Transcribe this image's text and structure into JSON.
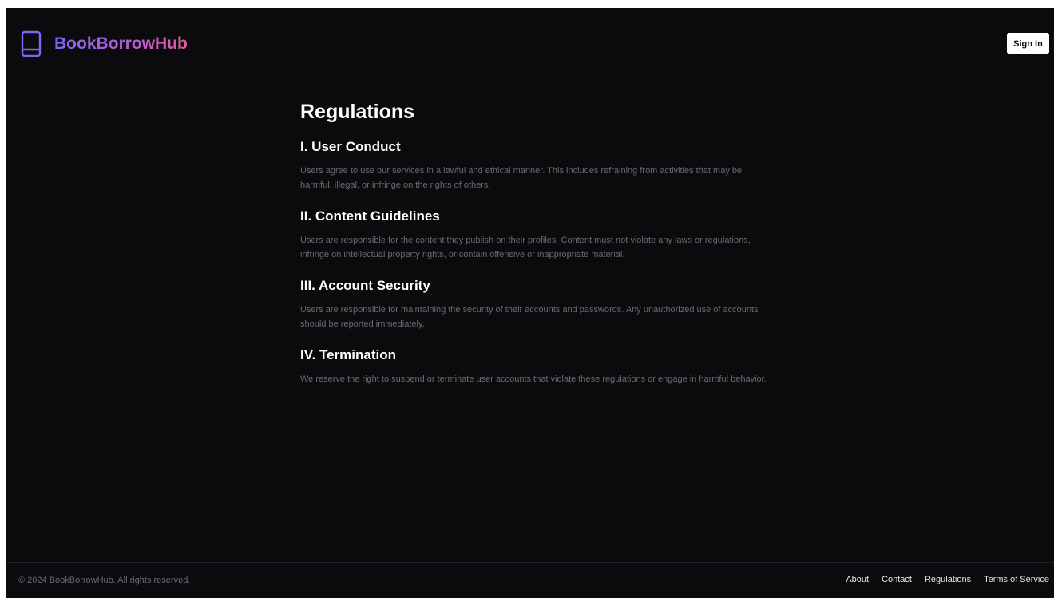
{
  "brand": {
    "name": "BookBorrowHub",
    "icon": "book-icon",
    "accent_start": "#7c67f6",
    "accent_end": "#e85a9e"
  },
  "header": {
    "sign_in_label": "Sign In"
  },
  "main": {
    "title": "Regulations",
    "sections": [
      {
        "heading": "I. User Conduct",
        "body": "Users agree to use our services in a lawful and ethical manner. This includes refraining from activities that may be harmful, illegal, or infringe on the rights of others."
      },
      {
        "heading": "II. Content Guidelines",
        "body": "Users are responsible for the content they publish on their profiles. Content must not violate any laws or regulations, infringe on intellectual property rights, or contain offensive or inappropriate material."
      },
      {
        "heading": "III. Account Security",
        "body": "Users are responsible for maintaining the security of their accounts and passwords. Any unauthorized use of accounts should be reported immediately."
      },
      {
        "heading": "IV. Termination",
        "body": "We reserve the right to suspend or terminate user accounts that violate these regulations or engage in harmful behavior."
      }
    ]
  },
  "footer": {
    "copyright": "© 2024 BookBorrowHub. All rights reserved.",
    "links": [
      {
        "label": "About"
      },
      {
        "label": "Contact"
      },
      {
        "label": "Regulations"
      },
      {
        "label": "Terms of Service"
      }
    ]
  },
  "colors": {
    "background": "#0b0b0e",
    "muted_text": "#6a6a72",
    "heading_text": "#ffffff"
  }
}
